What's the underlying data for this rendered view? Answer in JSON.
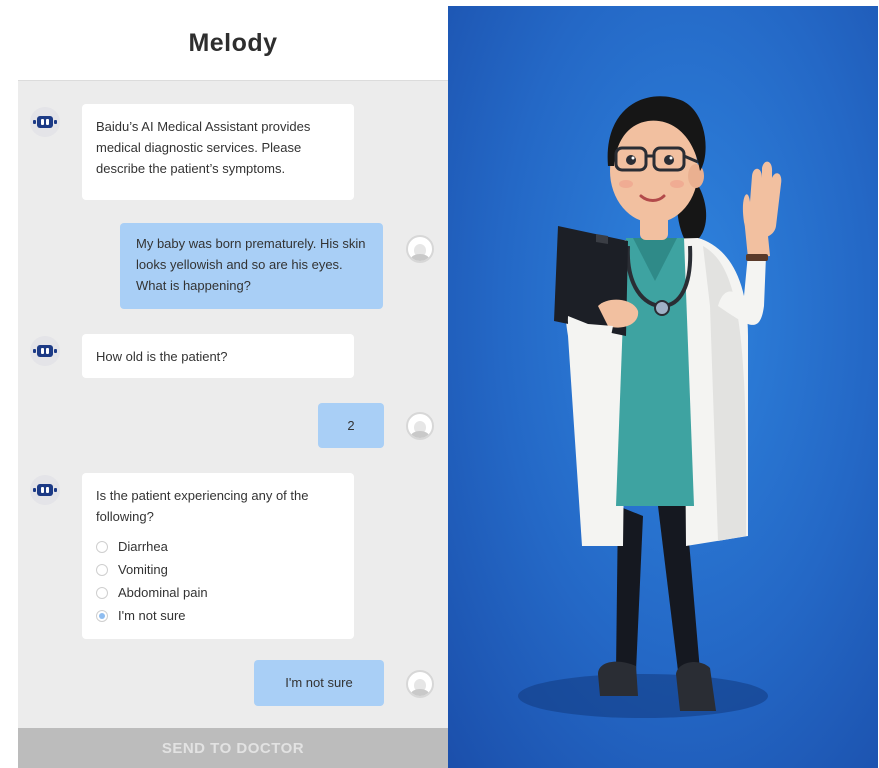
{
  "header": {
    "title": "Melody"
  },
  "messages": {
    "bot1": "Baidu’s AI Medical Assistant provides medical diagnostic services. Please describe the patient’s symptoms.",
    "user1": "My baby was born prematurely. His skin looks yellowish and so are his eyes. What is happening?",
    "bot2": "How old is the patient?",
    "user2": "2",
    "bot3": {
      "question": "Is the patient experiencing any of the following?",
      "options": [
        {
          "label": "Diarrhea",
          "selected": false
        },
        {
          "label": "Vomiting",
          "selected": false
        },
        {
          "label": "Abdominal pain",
          "selected": false
        },
        {
          "label": "I'm not sure",
          "selected": true
        }
      ]
    },
    "user3": "I'm not sure"
  },
  "send_button": {
    "label": "SEND TO DOCTOR"
  },
  "icons": {
    "bot_avatar": "robot-icon",
    "user_avatar": "user-avatar-icon"
  },
  "colors": {
    "chat_background": "#ececec",
    "user_bubble": "#a9cff6",
    "bot_bubble": "#ffffff",
    "send_button": "#bcbcbc",
    "doctor_background": "#2468c6"
  }
}
